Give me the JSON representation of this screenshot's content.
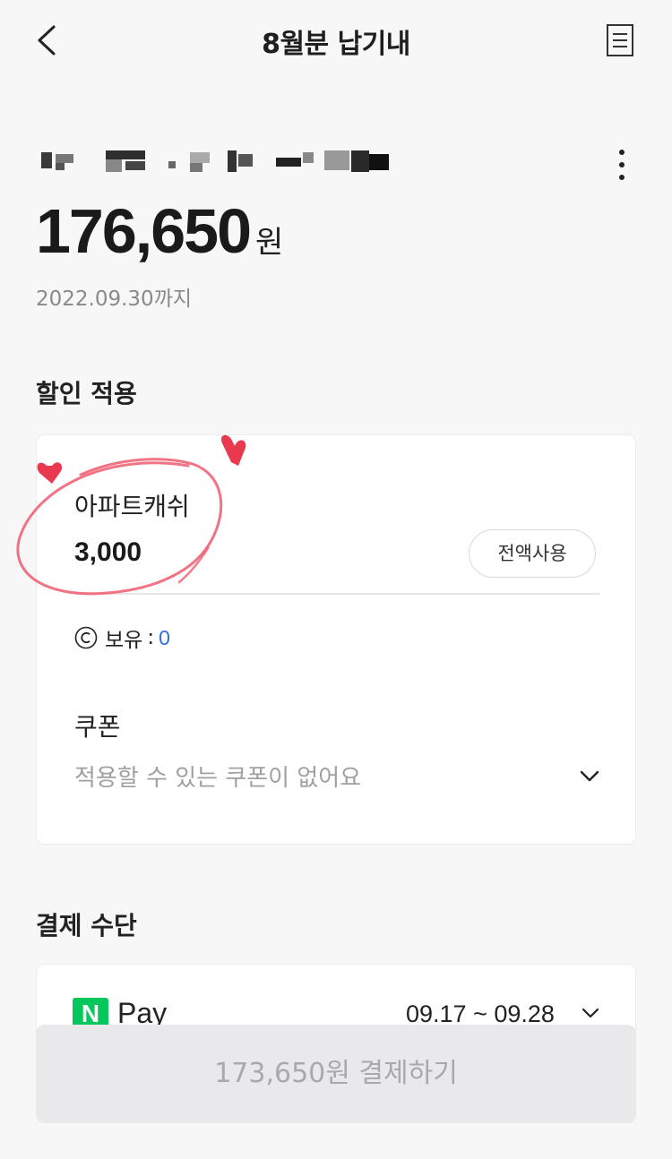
{
  "header": {
    "title": "8월분 납기내",
    "back_icon": "chevron-left-icon",
    "receipt_icon": "receipt-icon"
  },
  "bill": {
    "amount": "176,650",
    "currency_unit": "원",
    "due_date": "2022.09.30까지",
    "more_icon": "more-vertical-icon"
  },
  "discount": {
    "section_title": "할인 적용",
    "cash_label": "아파트캐쉬",
    "cash_value": "3,000",
    "use_all_label": "전액사용",
    "balance_label": "보유",
    "balance_value": "0",
    "coupon_label": "쿠폰",
    "coupon_placeholder": "적용할 수 있는 쿠폰이 없어요"
  },
  "payment": {
    "section_title": "결제 수단",
    "method_logo": "N",
    "method_name": "Pay",
    "period": "09.17 ~ 09.28"
  },
  "pay_button_label": "173,650원 결제하기",
  "colors": {
    "background": "#f7f7f8",
    "accent_blue": "#2f6fe0",
    "naver_green": "#03c75a",
    "annotation_red": "#e8394f"
  }
}
